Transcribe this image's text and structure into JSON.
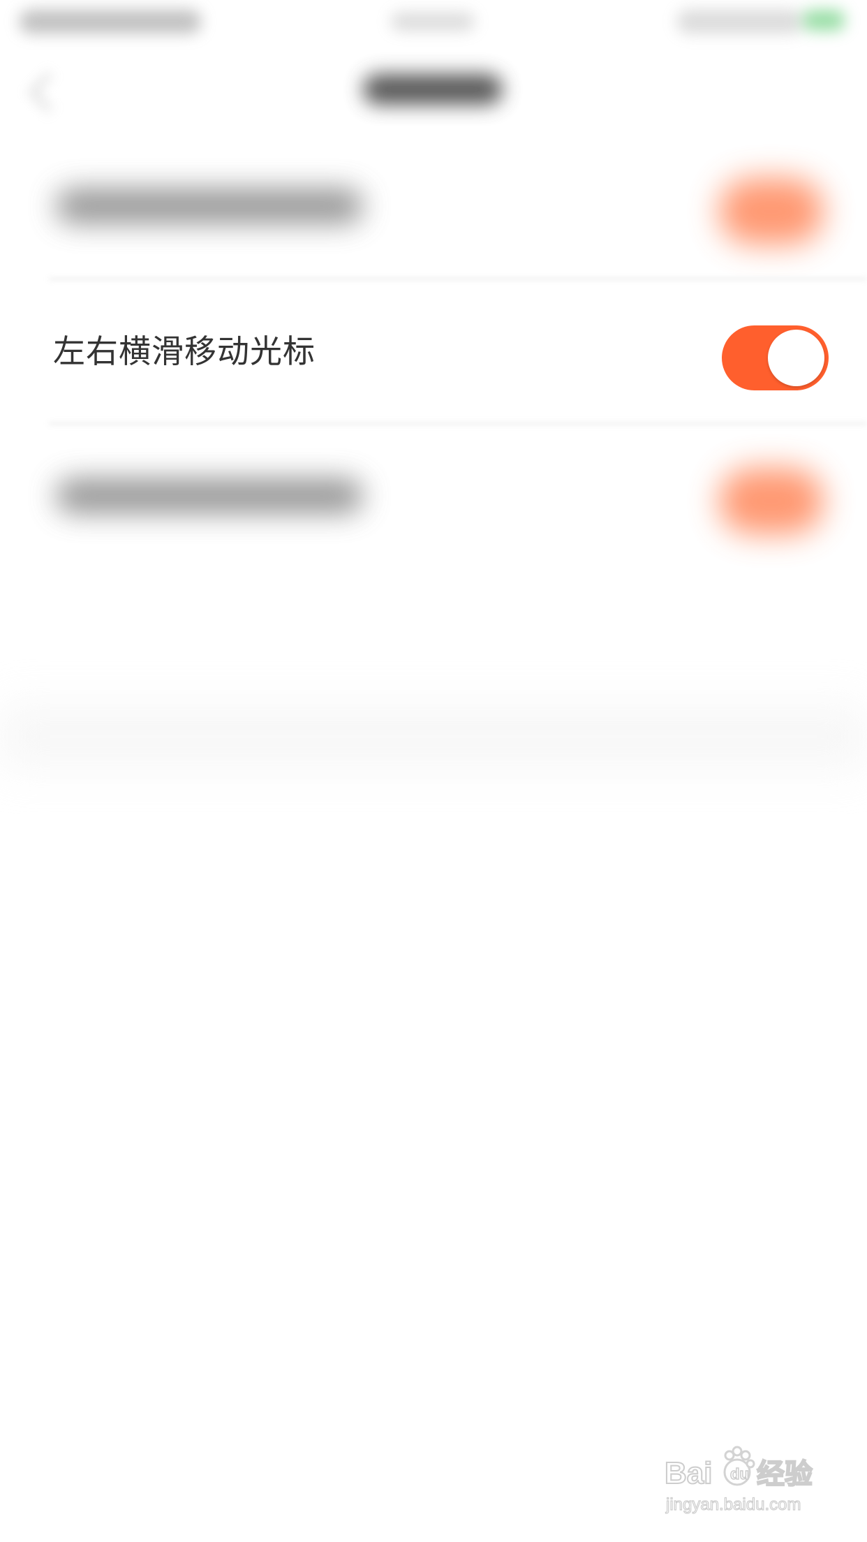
{
  "settings": {
    "swipe_cursor_row": {
      "label": "左右横滑移动光标",
      "enabled": true
    }
  },
  "colors": {
    "accent": "#ff5f2d",
    "toggle_knob": "#ffffff",
    "label_text": "#333333",
    "battery": "#46c35e"
  },
  "watermark": {
    "brand": "Baidu经验",
    "url": "jingyan.baidu.com"
  }
}
